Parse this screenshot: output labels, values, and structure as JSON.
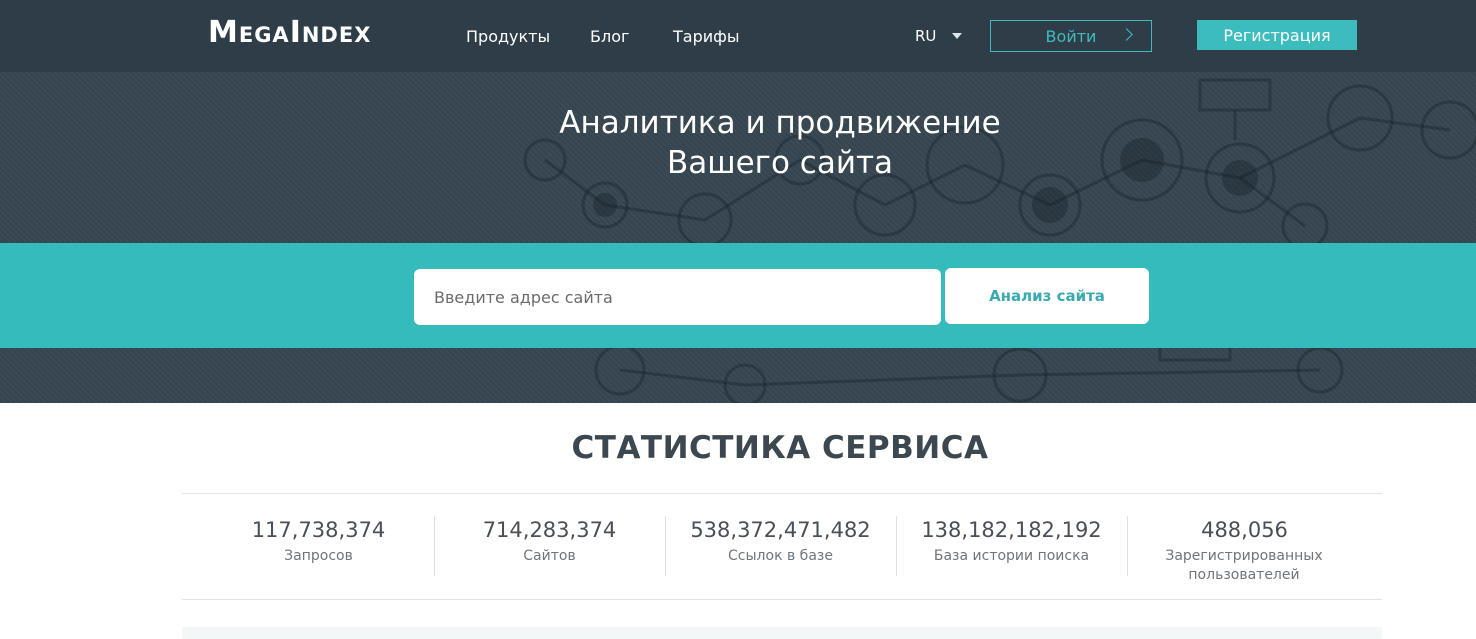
{
  "header": {
    "logo": "MegaIndex",
    "nav": [
      "Продукты",
      "Блог",
      "Тарифы"
    ],
    "language": "RU",
    "login_label": "Войти",
    "register_label": "Регистрация"
  },
  "hero": {
    "title_line1": "Аналитика и продвижение",
    "title_line2": "Вашего сайта"
  },
  "search": {
    "placeholder": "Введите адрес сайта",
    "button_label": "Анализ сайта"
  },
  "stats": {
    "title": "СТАТИСТИКА СЕРВИСА",
    "items": [
      {
        "value": "117,738,374",
        "label": "Запросов"
      },
      {
        "value": "714,283,374",
        "label": "Сайтов"
      },
      {
        "value": "538,372,471,482",
        "label": "Ссылок в базе"
      },
      {
        "value": "138,182,182,192",
        "label": "База истории поиска"
      },
      {
        "value": "488,056",
        "label": "Зарегистрированных пользователей"
      }
    ]
  },
  "colors": {
    "header_bg": "#2e3d48",
    "hero_bg": "#36454f",
    "accent": "#36bbbc"
  }
}
